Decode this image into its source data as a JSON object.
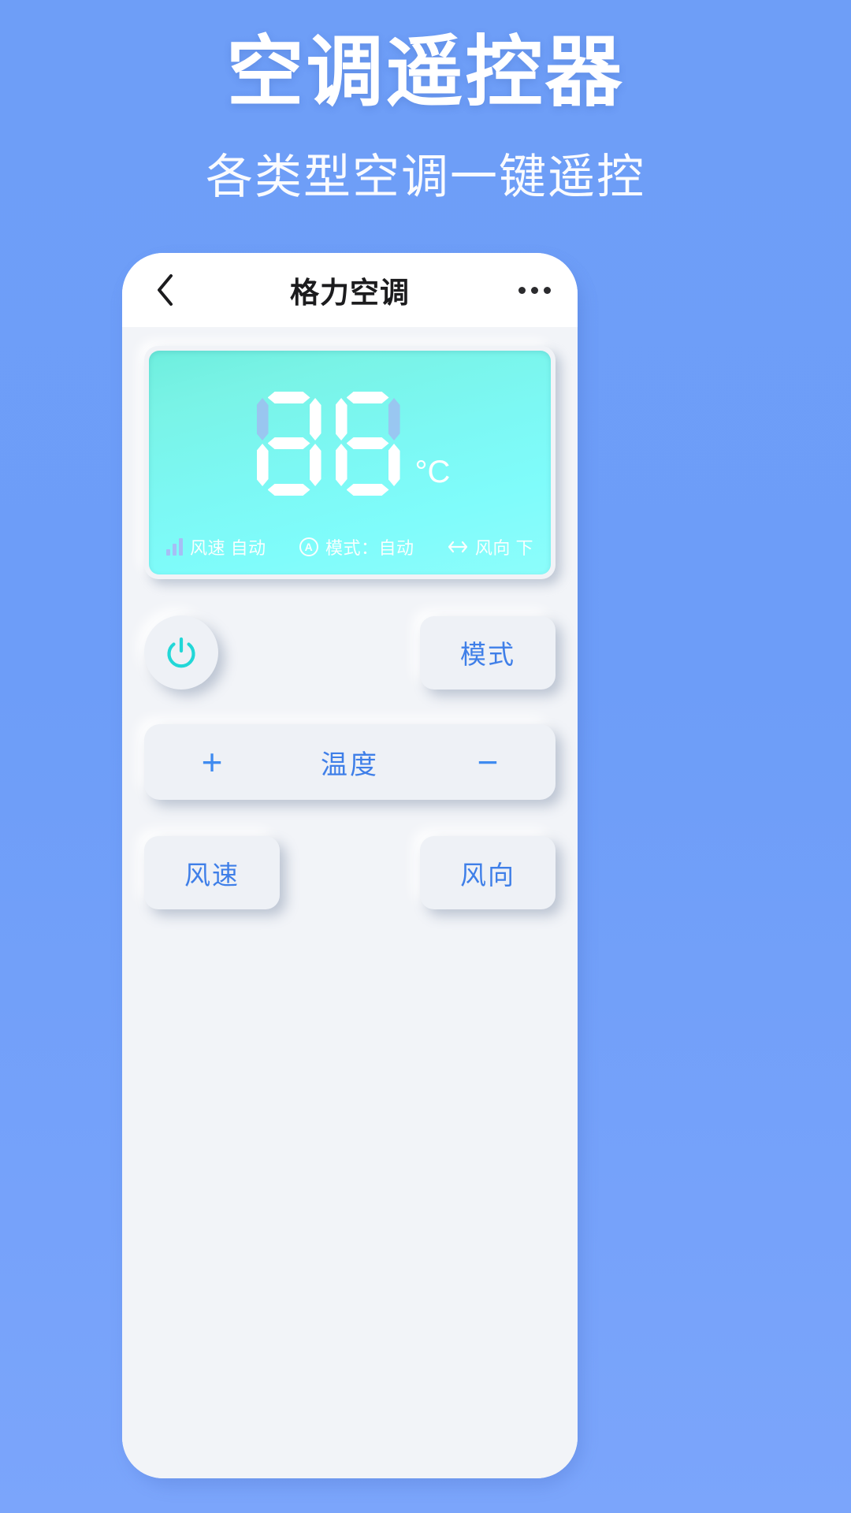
{
  "promo": {
    "title": "空调遥控器",
    "subtitle": "各类型空调一键遥控"
  },
  "colors": {
    "page_background": "#6e9ef7",
    "accent_blue": "#3f7fe8",
    "lcd_cyan": "#7cf8f4",
    "power_icon": "#22d7d7",
    "surface": "#eef1f6"
  },
  "navbar": {
    "back_icon": "chevron-left-icon",
    "title": "格力空调",
    "more_icon": "more-horizontal-icon"
  },
  "display": {
    "digits": [
      "8",
      "8"
    ],
    "digit_segments": [
      {
        "a": "on",
        "b": "on",
        "c": "on",
        "d": "on",
        "e": "on",
        "f": "off",
        "g": "on"
      },
      {
        "a": "on",
        "b": "off",
        "c": "on",
        "d": "on",
        "e": "on",
        "f": "on",
        "g": "on"
      }
    ],
    "unit": "°C",
    "status": [
      {
        "icon": "signal-bars-icon",
        "label": "风速 自动"
      },
      {
        "icon": "auto-mode-icon",
        "icon_glyph": "A",
        "label": "模式：自动"
      },
      {
        "icon": "swing-arrows-icon",
        "label": "风向 下"
      }
    ]
  },
  "controls": {
    "power_icon": "power-icon",
    "mode_label": "模式",
    "temp_increase": "+",
    "temp_label": "温度",
    "temp_decrease": "−",
    "fan_label": "风速",
    "direction_label": "风向"
  }
}
